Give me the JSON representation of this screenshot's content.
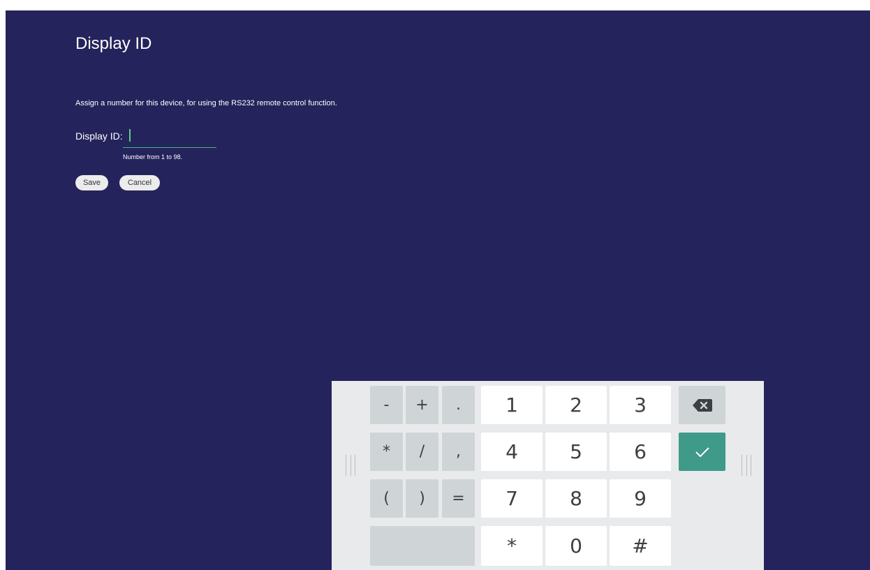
{
  "page": {
    "title": "Display ID",
    "description": "Assign a number for this device, for using the RS232 remote control function.",
    "field_label": "Display ID:",
    "input_value": "",
    "hint": "Number from 1 to 98.",
    "save_label": "Save",
    "cancel_label": "Cancel"
  },
  "keyboard": {
    "symbols": [
      "-",
      "+",
      ".",
      "*",
      "/",
      ",",
      "(",
      ")",
      "="
    ],
    "digits": [
      "1",
      "2",
      "3",
      "4",
      "5",
      "6",
      "7",
      "8",
      "9",
      "*",
      "0",
      "#"
    ],
    "backspace_icon": "backspace-icon",
    "enter_icon": "checkmark-icon",
    "handle_icon": "drag-handle-icon"
  },
  "colors": {
    "background": "#24235b",
    "accent": "#3f9a89",
    "input_underline": "#42b883",
    "keyboard_bg": "#e9eaeb"
  }
}
